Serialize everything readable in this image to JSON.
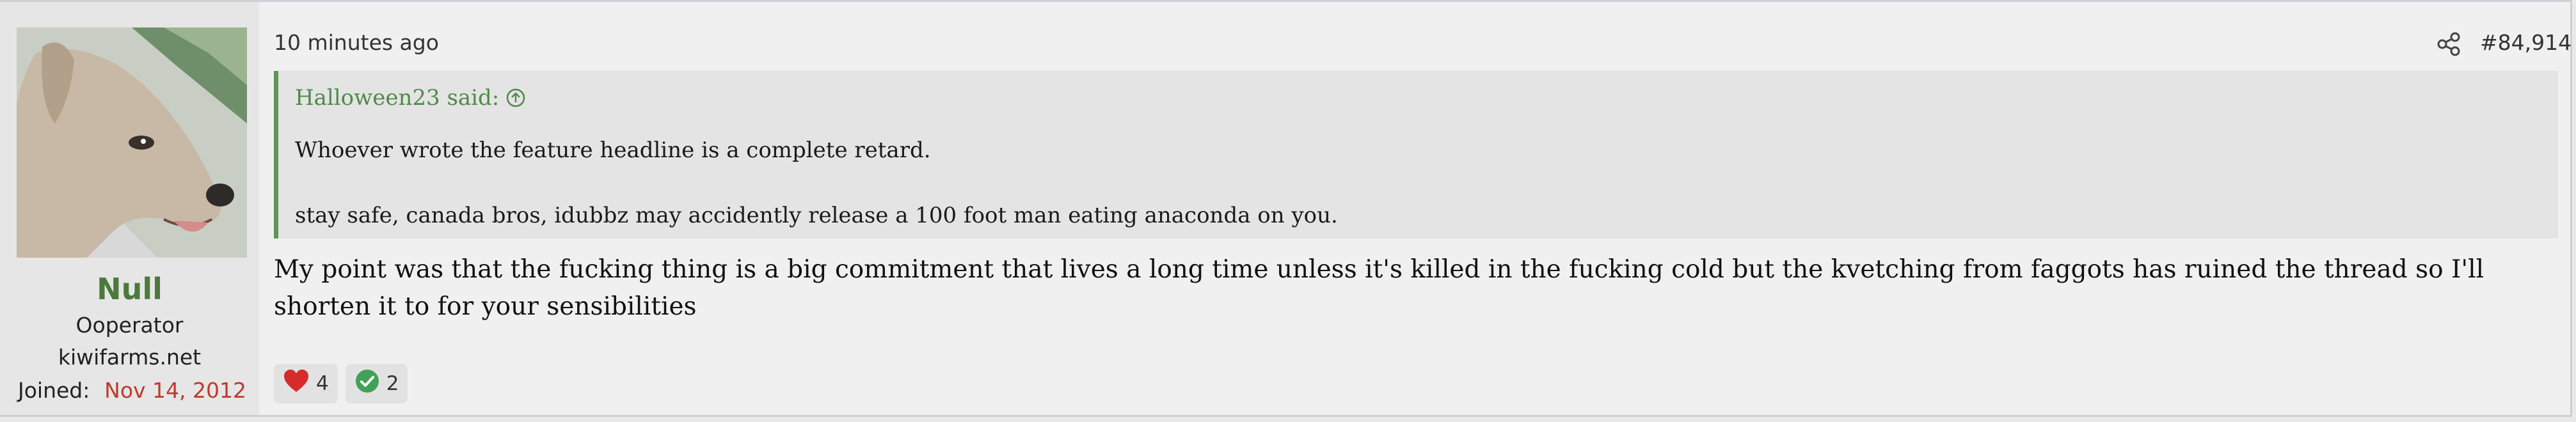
{
  "user": {
    "name": "Null",
    "title": "Ooperator",
    "site": "kiwifarms.net",
    "joined_label": "Joined:",
    "joined_value": "Nov 14, 2012"
  },
  "post": {
    "time": "10 minutes ago",
    "number": "#84,914",
    "quote": {
      "author": "Halloween23 said:",
      "lines": [
        "Whoever wrote the feature headline is a complete retard.",
        "stay safe, canada bros, idubbz may accidently release a 100 foot man eating anaconda on you."
      ]
    },
    "body": "My point was that the fucking thing is a big commitment that lives a long time unless it's killed in the fucking cold but the kvetching from faggots has ruined the thread so I'll shorten it to for your sensibilities",
    "reactions": [
      {
        "icon": "heart-icon",
        "count": "4",
        "color": "#d62b2b"
      },
      {
        "icon": "check-icon",
        "count": "2",
        "color": "#3fa257"
      }
    ]
  },
  "colors": {
    "username": "#4c7a3a",
    "quote_border": "#5d9655",
    "joined_date": "#c0392b"
  }
}
